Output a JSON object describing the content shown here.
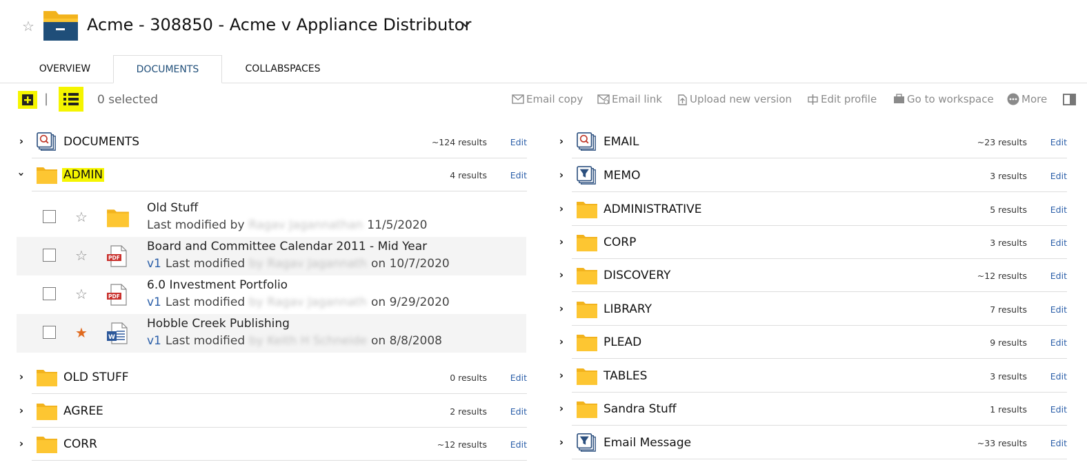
{
  "header": {
    "title": "Acme - 308850 - Acme v Appliance Distributor",
    "star_icon": "star-outline-icon",
    "folder_icon": "workspace-folder-icon",
    "chevron_icon": "chevron-down-icon"
  },
  "tabs": [
    {
      "label": "OVERVIEW",
      "active": false
    },
    {
      "label": "DOCUMENTS",
      "active": true
    },
    {
      "label": "COLLABSPACES",
      "active": false
    }
  ],
  "toolbar": {
    "separator": "|",
    "selected_text": "0 selected",
    "actions": {
      "email_copy": "Email copy",
      "email_link": "Email link",
      "upload_new_version": "Upload new version",
      "edit_profile": "Edit profile",
      "go_to_workspace": "Go to workspace",
      "more": "More"
    },
    "highlight_color": "#f5f500"
  },
  "edit_label": "Edit",
  "left_groups": {
    "documents": {
      "name": "DOCUMENTS",
      "count": "~124 results",
      "icon": "search-folder-icon",
      "expanded": false
    },
    "admin": {
      "name": "ADMIN",
      "count": "4 results",
      "icon": "folder-icon",
      "expanded": true
    },
    "old_stuff": {
      "name": "OLD STUFF",
      "count": "0 results",
      "icon": "folder-icon",
      "expanded": false
    },
    "agree": {
      "name": "AGREE",
      "count": "2 results",
      "icon": "folder-icon",
      "expanded": false
    },
    "corr": {
      "name": "CORR",
      "count": "~12 results",
      "icon": "folder-icon",
      "expanded": false
    }
  },
  "admin_items": [
    {
      "title": "Old Stuff",
      "version": "",
      "meta_prefix": "Last modified by",
      "author": "Ragav Jagannathan",
      "date": "11/5/2020",
      "starred": false,
      "icon": "folder-icon"
    },
    {
      "title": "Board and Committee Calendar 2011 - Mid Year",
      "version": "v1",
      "meta_prefix": "Last modified",
      "author": "by Ragav Jagannath",
      "date": "on 10/7/2020",
      "starred": false,
      "icon": "pdf-icon"
    },
    {
      "title": "6.0 Investment Portfolio",
      "version": "v1",
      "meta_prefix": "Last modified",
      "author": "by Ragav Jagannath",
      "date": "on 9/29/2020",
      "starred": false,
      "icon": "pdf-icon"
    },
    {
      "title": "Hobble Creek Publishing",
      "version": "v1",
      "meta_prefix": "Last modified",
      "author": "by Keith H Schneide",
      "date": "on 8/8/2008",
      "starred": true,
      "icon": "word-doc-icon"
    }
  ],
  "right_groups": [
    {
      "name": "EMAIL",
      "count": "~23 results",
      "icon": "search-folder-icon"
    },
    {
      "name": "MEMO",
      "count": "3 results",
      "icon": "filter-folder-icon"
    },
    {
      "name": "ADMINISTRATIVE",
      "count": "5 results",
      "icon": "folder-icon"
    },
    {
      "name": "CORP",
      "count": "3 results",
      "icon": "folder-icon"
    },
    {
      "name": "DISCOVERY",
      "count": "~12 results",
      "icon": "folder-icon"
    },
    {
      "name": "LIBRARY",
      "count": "7 results",
      "icon": "folder-icon"
    },
    {
      "name": "PLEAD",
      "count": "9 results",
      "icon": "folder-icon"
    },
    {
      "name": "TABLES",
      "count": "3 results",
      "icon": "folder-icon"
    },
    {
      "name": "Sandra Stuff",
      "count": "1 results",
      "icon": "folder-icon"
    },
    {
      "name": "Email Message",
      "count": "~33 results",
      "icon": "filter-folder-icon"
    }
  ],
  "colors": {
    "folder": "#fdc632",
    "workspace_blue": "#1f4e79",
    "link": "#2a5ea8",
    "star_active": "#e06a1e"
  }
}
